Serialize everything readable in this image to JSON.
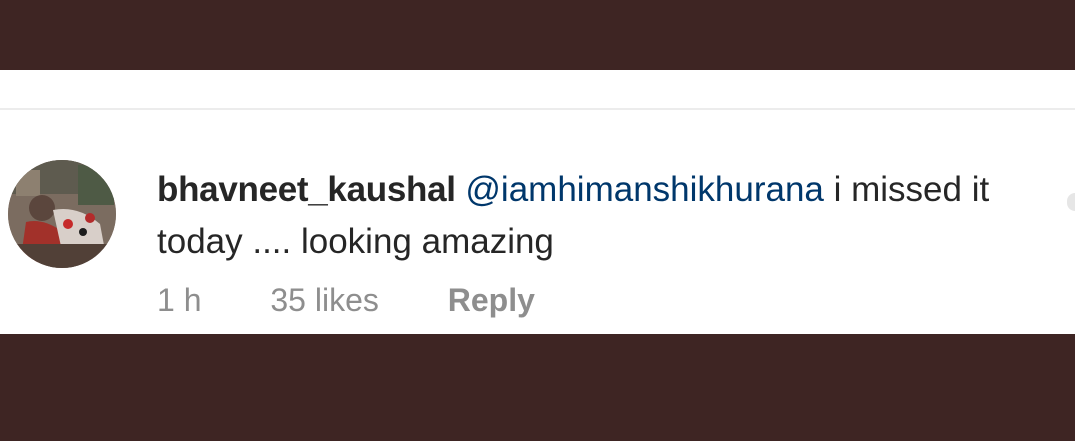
{
  "comment": {
    "username": "bhavneet_kaushal",
    "mention": "@iamhimanshikhurana",
    "text": " i missed it today .... looking amazing",
    "time": "1 h",
    "likes": "35 likes",
    "reply_label": "Reply"
  },
  "avatar": {
    "icon": "profile-photo"
  },
  "colors": {
    "background": "#3e2523",
    "card": "#ffffff",
    "username": "#262626",
    "mention": "#00376b",
    "meta": "#8e8e8e"
  }
}
